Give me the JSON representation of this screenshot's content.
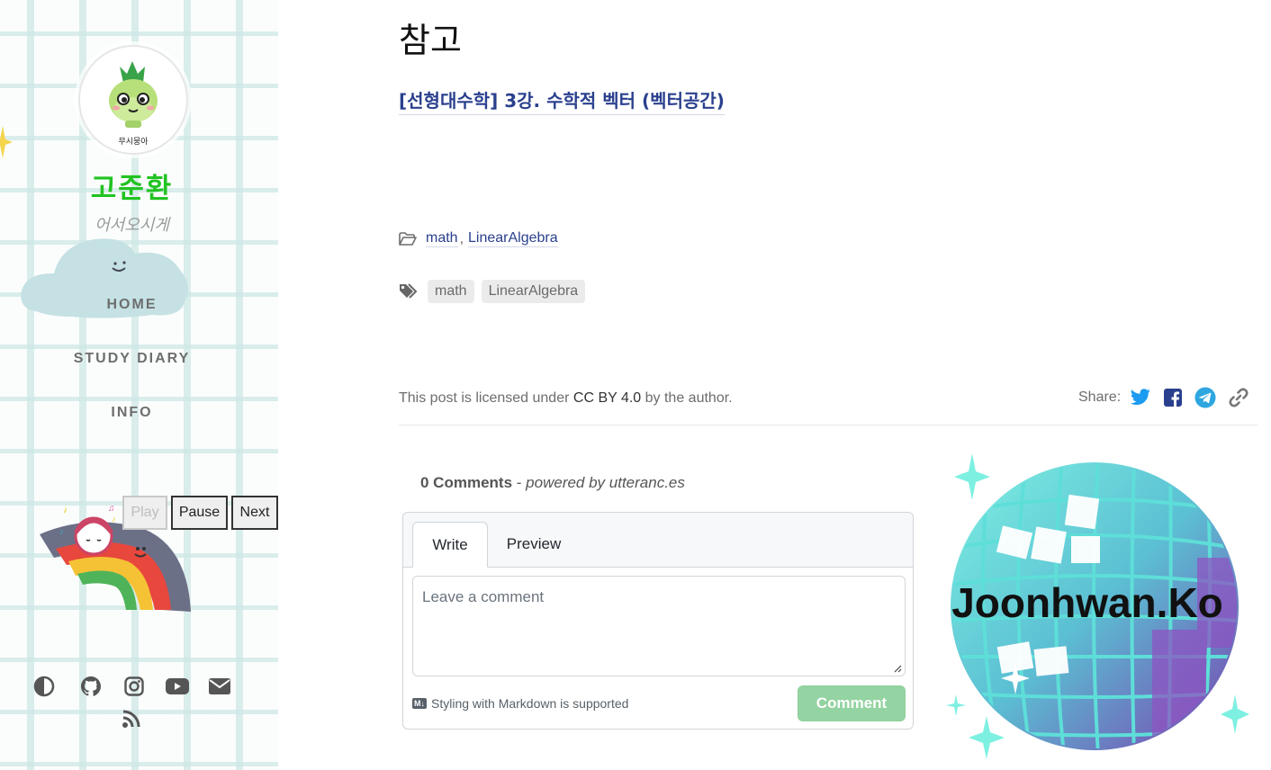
{
  "sidebar": {
    "avatar_caption": "무시뭉아",
    "title": "고준환",
    "subtitle": "어서오시게",
    "nav": [
      {
        "label": "HOME"
      },
      {
        "label": "STUDY DIARY"
      },
      {
        "label": "INFO"
      }
    ],
    "player": {
      "play": "Play",
      "pause": "Pause",
      "next": "Next"
    },
    "icons": [
      "theme-toggle-icon",
      "github-icon",
      "instagram-icon",
      "youtube-icon",
      "email-icon",
      "rss-icon"
    ]
  },
  "main": {
    "heading": "참고",
    "reference_link": "[선형대수학] 3강. 수학적 벡터 (벡터공간)",
    "categories": [
      "math",
      "LinearAlgebra"
    ],
    "category_separator": ",",
    "tags": [
      "math",
      "LinearAlgebra"
    ],
    "license": {
      "prefix": "This post is licensed under",
      "license_name": "CC BY 4.0",
      "suffix": "by the author."
    },
    "share": {
      "label": "Share:",
      "icons": [
        "twitter-icon",
        "facebook-icon",
        "telegram-icon",
        "link-icon"
      ]
    }
  },
  "comments": {
    "count_label": "0 Comments",
    "separator": "-",
    "powered_by": "powered by utteranc.es",
    "tabs": [
      "Write",
      "Preview"
    ],
    "placeholder": "Leave a comment",
    "markdown_badge": "M↓",
    "markdown_note": "Styling with Markdown is supported",
    "submit_label": "Comment"
  },
  "decor": {
    "disco_text": "Joonhwan.Ko"
  },
  "colors": {
    "title_green": "#22c322",
    "link_blue": "#2a408e",
    "comment_button": "#94d3a2",
    "twitter": "#1d9bf0",
    "facebook": "#2a408e",
    "telegram": "#2ea6e0"
  }
}
